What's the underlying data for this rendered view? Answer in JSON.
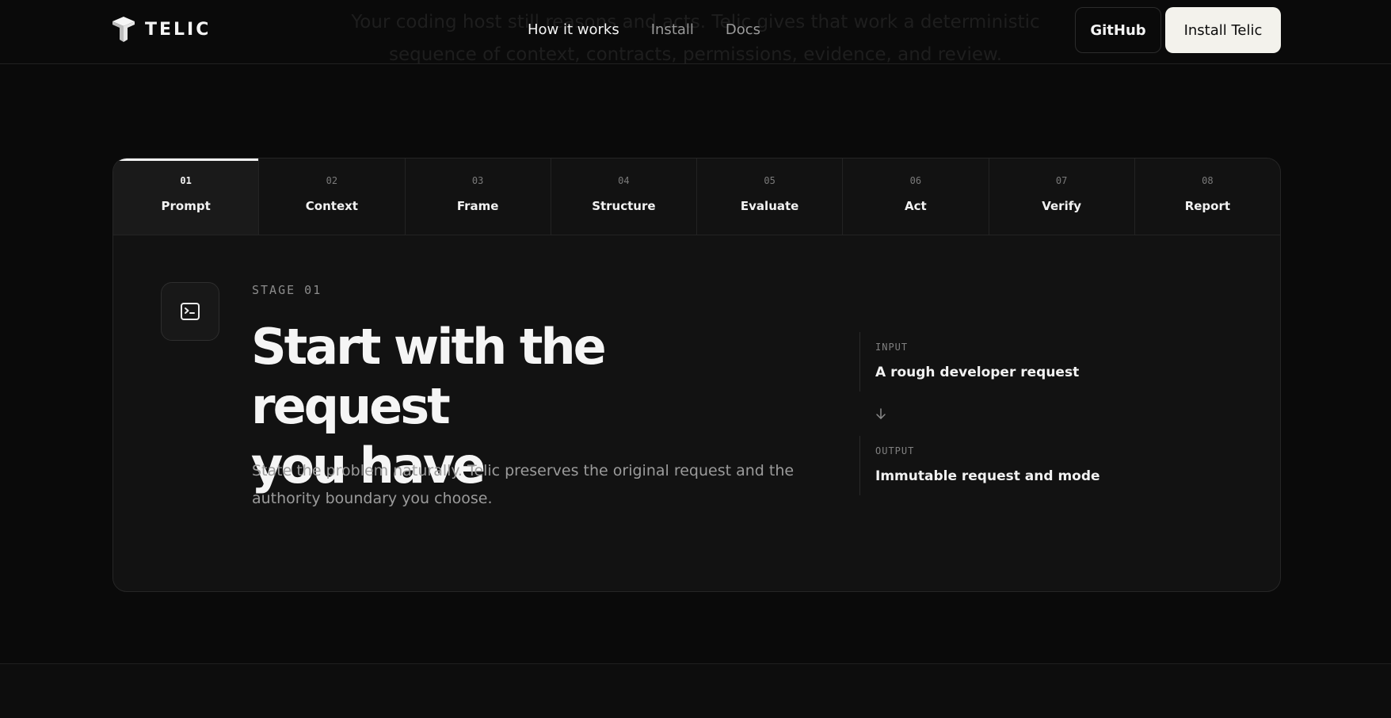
{
  "hero": {
    "line1": "Your coding host still reasons and acts. Telic gives that work a deterministic",
    "line2": "sequence of context, contracts, permissions, evidence, and review."
  },
  "header": {
    "logo_text": "TELIC",
    "nav": [
      {
        "label": "How it works",
        "active": true
      },
      {
        "label": "Install",
        "active": false
      },
      {
        "label": "Docs",
        "active": false
      }
    ],
    "github_label": "GitHub",
    "install_label": "Install Telic"
  },
  "tabs": [
    {
      "num": "01",
      "label": "Prompt",
      "active": true
    },
    {
      "num": "02",
      "label": "Context",
      "active": false
    },
    {
      "num": "03",
      "label": "Frame",
      "active": false
    },
    {
      "num": "04",
      "label": "Structure",
      "active": false
    },
    {
      "num": "05",
      "label": "Evaluate",
      "active": false
    },
    {
      "num": "06",
      "label": "Act",
      "active": false
    },
    {
      "num": "07",
      "label": "Verify",
      "active": false
    },
    {
      "num": "08",
      "label": "Report",
      "active": false
    }
  ],
  "stage": {
    "icon": "terminal-icon",
    "kicker": "STAGE 01",
    "title_line1": "Start with the request",
    "title_line2": "you have",
    "description": "State the problem naturally. Telic preserves the original request and the authority boundary you choose.",
    "input_label": "INPUT",
    "input_value": "A rough developer request",
    "output_label": "OUTPUT",
    "output_value": "Immutable request and mode"
  },
  "colors": {
    "background": "#0a0a0a",
    "card": "#121212",
    "text": "#f2f2f2",
    "muted": "#9b9b9b",
    "install_button": "#f3f2ec"
  }
}
